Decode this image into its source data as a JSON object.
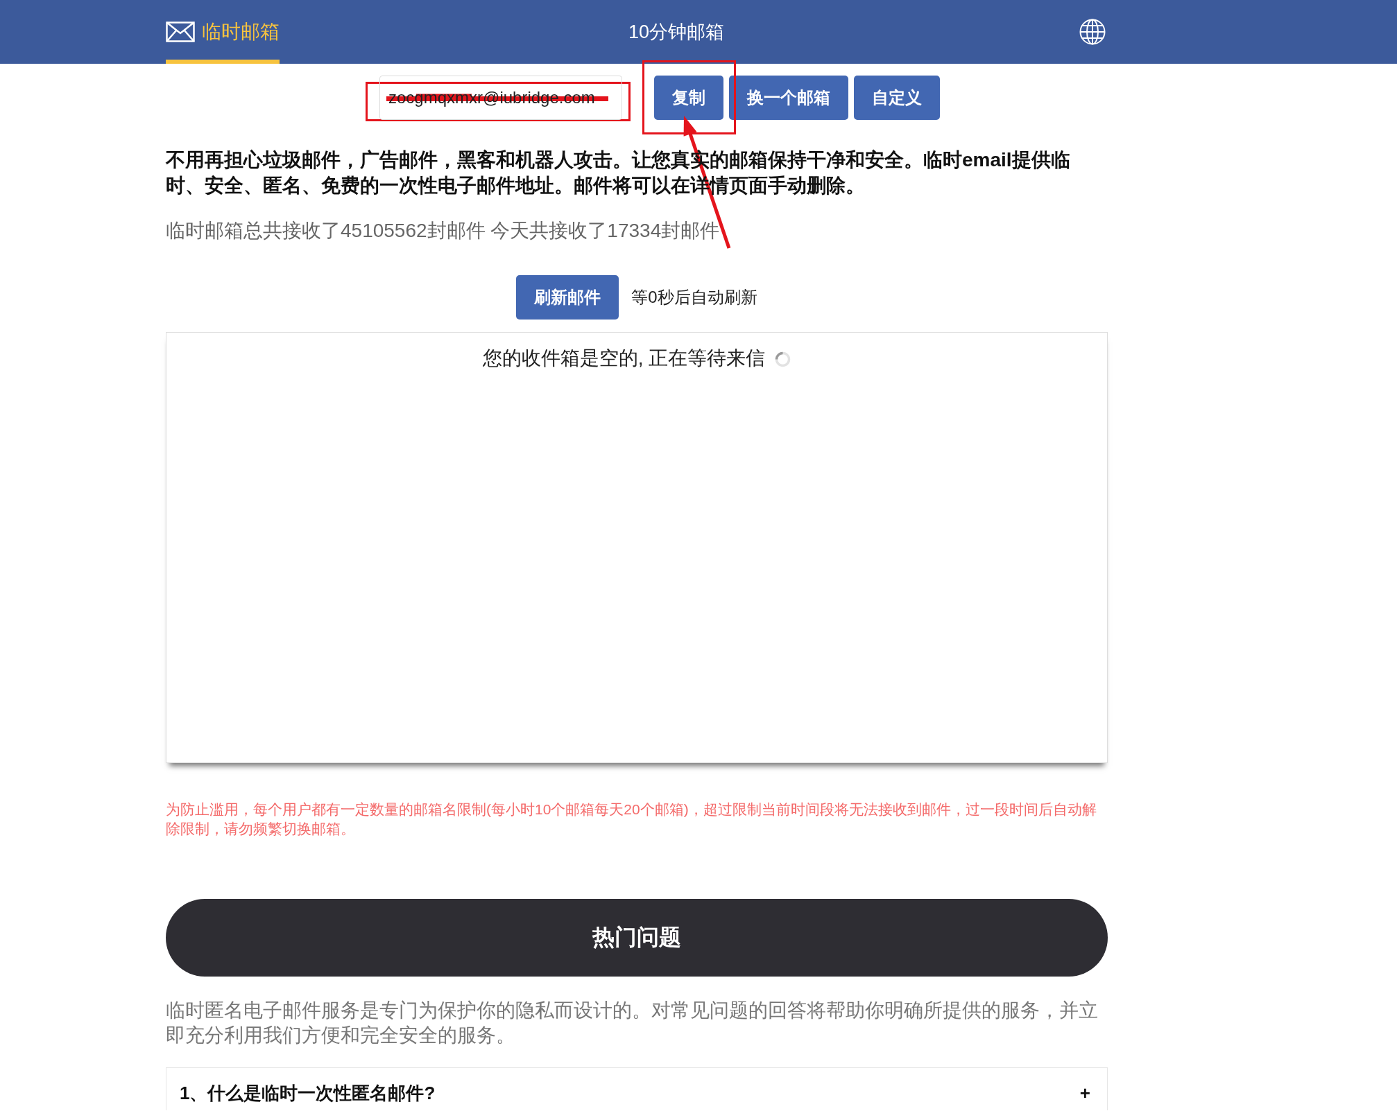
{
  "nav": [
    {
      "kind": "logo",
      "label": "临时邮箱",
      "selected": true
    },
    {
      "kind": "link",
      "label": "10分钟邮箱",
      "selected": false
    }
  ],
  "mailbox": {
    "address": "zocgmqxmxr@iubridge.com",
    "buttons": [
      "复制",
      "换一个邮箱",
      "自定义"
    ]
  },
  "intro": "不用再担心垃圾邮件，广告邮件，黑客和机器人攻击。让您真实的邮箱保持干净和安全。临时email提供临时、安全、匿名、免费的一次性电子邮件地址。邮件将可以在详情页面手动删除。",
  "stats": "临时邮箱总共接收了45105562封邮件 今天共接收了17334封邮件",
  "refresh": {
    "button": "刷新邮件",
    "countdown": "等0秒后自动刷新"
  },
  "inbox": {
    "message": "您的收件箱是空的, 正在等待来信",
    "loading": true
  },
  "notice": "为防止滥用，每个用户都有一定数量的邮箱名限制(每小时10个邮箱每天20个邮箱)，超过限制当前时间段将无法接收到邮件，过一段时间后自动解除限制，请勿频繁切换邮箱。",
  "faq": {
    "title": "热门问题",
    "description": "临时匿名电子邮件服务是专门为保护你的隐私而设计的。对常见问题的回答将帮助你明确所提供的服务，并立即充分利用我们方便和完全安全的服务。",
    "items": [
      {
        "question": "1、什么是临时一次性匿名邮件?",
        "toggle": "+"
      }
    ]
  }
}
